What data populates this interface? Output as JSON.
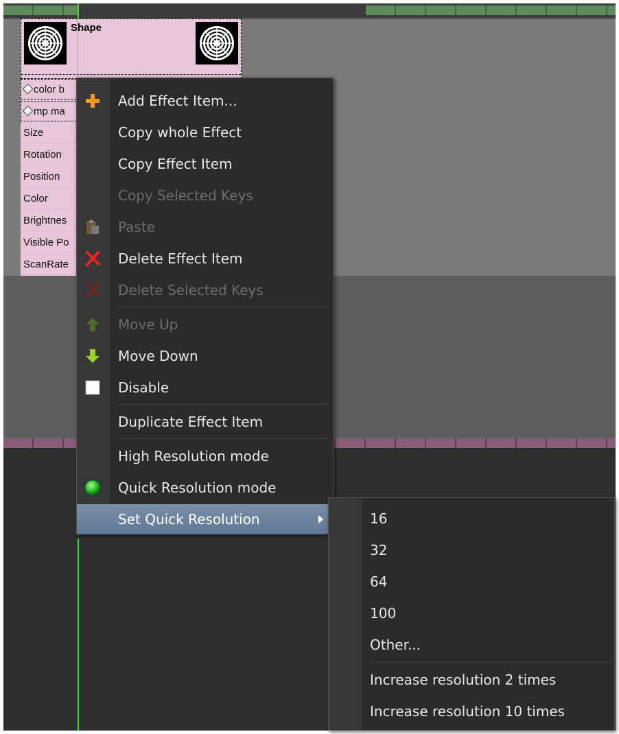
{
  "node": {
    "title": "Shape",
    "params": [
      "color b",
      "mp ma",
      "Size",
      "Rotation",
      "Position",
      "Color",
      "Brightnes",
      "Visible Po",
      "ScanRate"
    ]
  },
  "menu": {
    "items": [
      {
        "label": "Add Effect Item...",
        "icon": "plus-icon",
        "enabled": true
      },
      {
        "label": "Copy whole Effect",
        "icon": "",
        "enabled": true
      },
      {
        "label": "Copy Effect Item",
        "icon": "",
        "enabled": true
      },
      {
        "label": "Copy Selected Keys",
        "icon": "",
        "enabled": false
      },
      {
        "label": "Paste",
        "icon": "clipboard-icon",
        "enabled": false
      },
      {
        "label": "Delete Effect Item",
        "icon": "delete-x-icon",
        "enabled": true
      },
      {
        "label": "Delete Selected Keys",
        "icon": "delete-x-icon",
        "enabled": false
      },
      {
        "label": "Move Up",
        "icon": "arrow-up-icon",
        "enabled": false
      },
      {
        "label": "Move Down",
        "icon": "arrow-down-icon",
        "enabled": true
      },
      {
        "label": "Disable",
        "icon": "checkbox-icon",
        "enabled": true,
        "checked": false
      },
      {
        "label": "Duplicate Effect Item",
        "icon": "",
        "enabled": true
      },
      {
        "label": "High Resolution mode",
        "icon": "",
        "enabled": true
      },
      {
        "label": "Quick Resolution mode",
        "icon": "radio-dot-icon",
        "enabled": true,
        "selected": true
      },
      {
        "label": "Set Quick Resolution",
        "icon": "submenu-arrow-icon",
        "enabled": true,
        "highlighted": true
      }
    ]
  },
  "submenu": {
    "items": [
      "16",
      "32",
      "64",
      "100",
      "Other...",
      "Increase resolution 2 times",
      "Increase resolution 10 times"
    ]
  },
  "colors": {
    "menu_bg": "#2b2b2b",
    "highlight": "#6a829d",
    "playhead": "#3bd63b",
    "node_bg": "#e6c6d8"
  }
}
